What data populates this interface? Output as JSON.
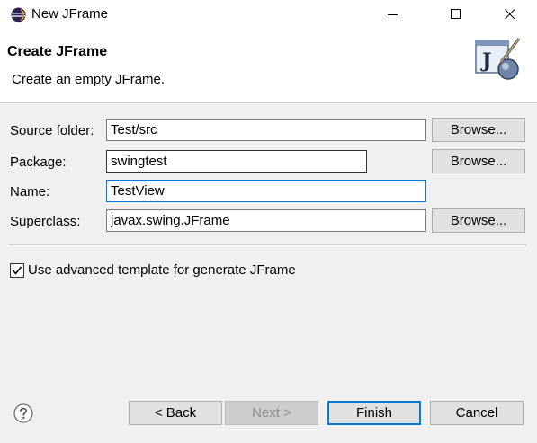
{
  "window": {
    "title": "New JFrame",
    "icon": "eclipse-icon",
    "controls": [
      "minimize-icon",
      "maximize-icon",
      "close-icon"
    ]
  },
  "header": {
    "title": "Create JFrame",
    "description": "Create an empty JFrame.",
    "image": "jframe-wizard-icon"
  },
  "form": {
    "source_folder": {
      "label": "Source folder:",
      "value": "Test/src",
      "browse": "Browse..."
    },
    "package": {
      "label": "Package:",
      "value": "swingtest",
      "browse": "Browse..."
    },
    "name": {
      "label": "Name:",
      "value": "TestView"
    },
    "superclass": {
      "label": "Superclass:",
      "value": "javax.swing.JFrame",
      "browse": "Browse..."
    }
  },
  "options": {
    "advanced_template": {
      "label": "Use advanced template for generate JFrame",
      "checked": true
    }
  },
  "footer": {
    "help_icon": "help-icon",
    "back": "< Back",
    "next": "Next >",
    "finish": "Finish",
    "cancel": "Cancel"
  },
  "colors": {
    "focus_accent": "#0078d7",
    "background": "#f0f0f0",
    "header_background": "#ffffff"
  }
}
